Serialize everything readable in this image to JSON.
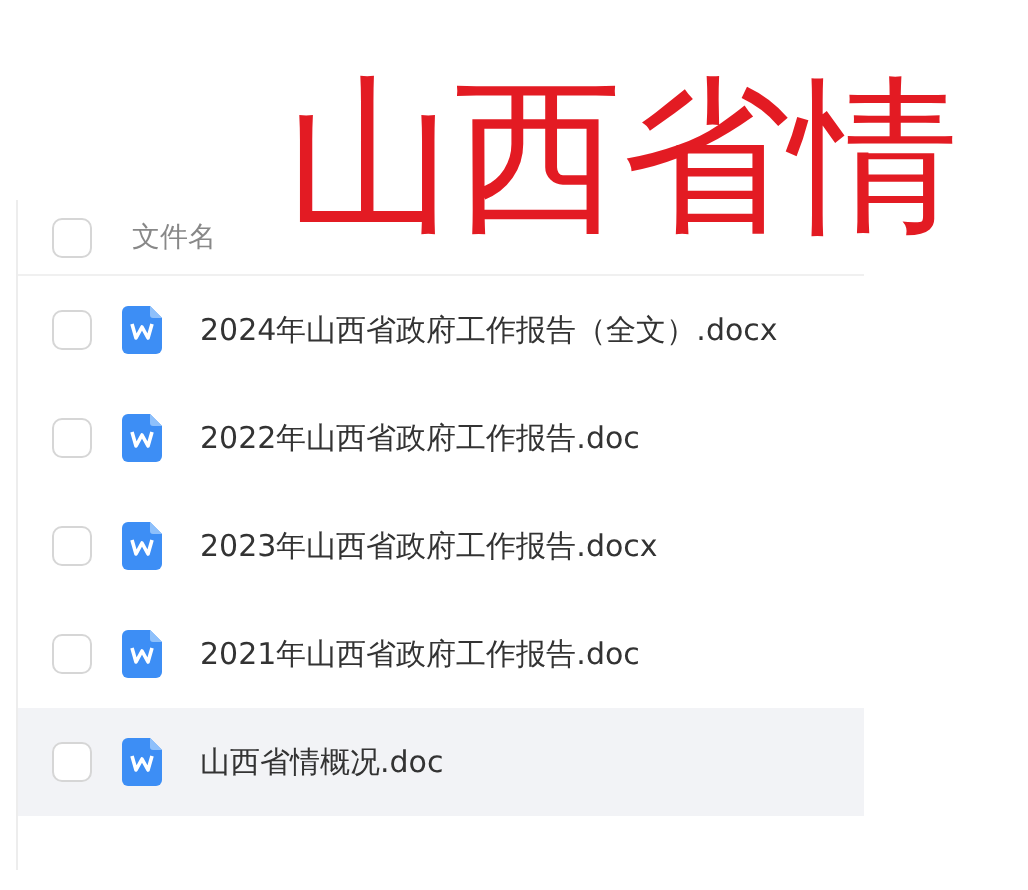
{
  "title": "山西省情",
  "header": {
    "label": "文件名",
    "checked": false
  },
  "files": [
    {
      "name": "2024年山西省政府工作报告（全文）.docx",
      "kind": "word",
      "checked": false,
      "highlighted": false
    },
    {
      "name": "2022年山西省政府工作报告.doc",
      "kind": "word",
      "checked": false,
      "highlighted": false
    },
    {
      "name": "2023年山西省政府工作报告.docx",
      "kind": "word",
      "checked": false,
      "highlighted": false
    },
    {
      "name": "2021年山西省政府工作报告.doc",
      "kind": "word",
      "checked": false,
      "highlighted": false
    },
    {
      "name": "山西省情概况.doc",
      "kind": "word",
      "checked": false,
      "highlighted": true
    }
  ]
}
